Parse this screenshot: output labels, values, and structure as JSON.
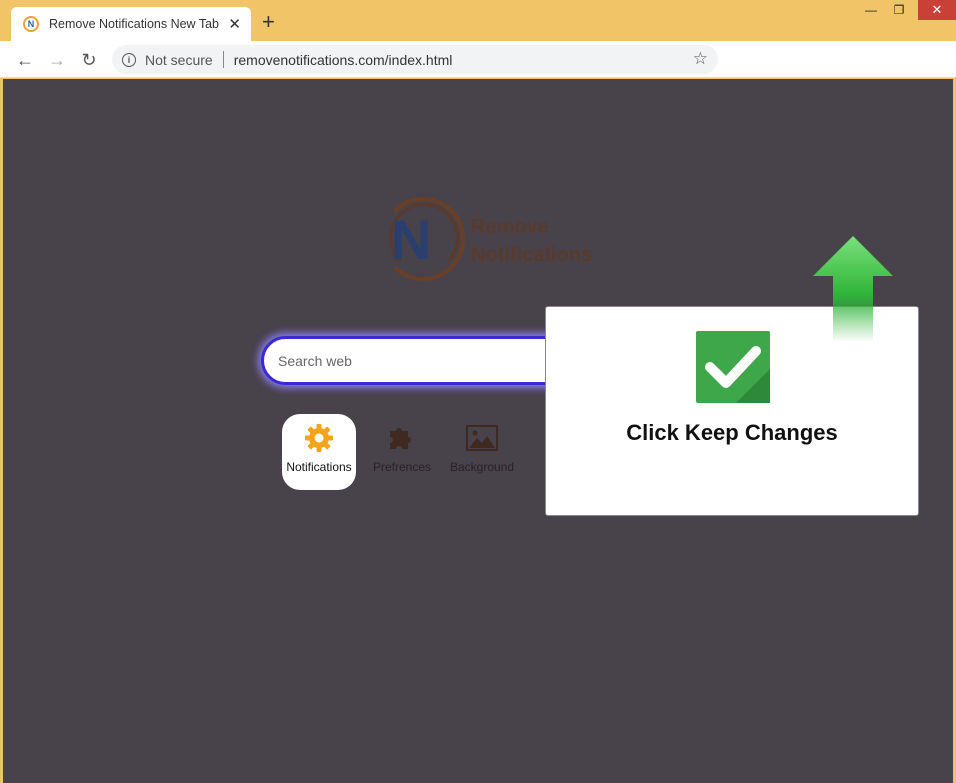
{
  "browser": {
    "tab_title": "Remove Notifications New Tab",
    "tab_favicon_letter": "N",
    "close_tab": "✕",
    "new_tab": "+",
    "window_min": "—",
    "window_max": "❐",
    "window_close": "✕"
  },
  "toolbar": {
    "back": "←",
    "forward": "→",
    "reload": "↻",
    "security_icon": "i",
    "security_label": "Not secure",
    "url": "removenotifications.com/index.html",
    "bookmark": "☆"
  },
  "logo": {
    "letter": "N",
    "line1": "Remove",
    "line2": "Notifications"
  },
  "search": {
    "placeholder": "Search web"
  },
  "shortcuts": [
    {
      "label": "Notifications",
      "icon": "gear-icon",
      "active": true
    },
    {
      "label": "Prefrences",
      "icon": "puzzle-icon",
      "active": false
    },
    {
      "label": "Background",
      "icon": "image-icon",
      "active": false
    }
  ],
  "popup": {
    "message": "Click Keep Changes",
    "icon": "checkmark-icon",
    "accent": "#3da74a"
  },
  "colors": {
    "page_bg": "#48424b",
    "titlebar": "#f2c468",
    "search_border": "#3b2ad0",
    "arrow": "#3fc447"
  }
}
